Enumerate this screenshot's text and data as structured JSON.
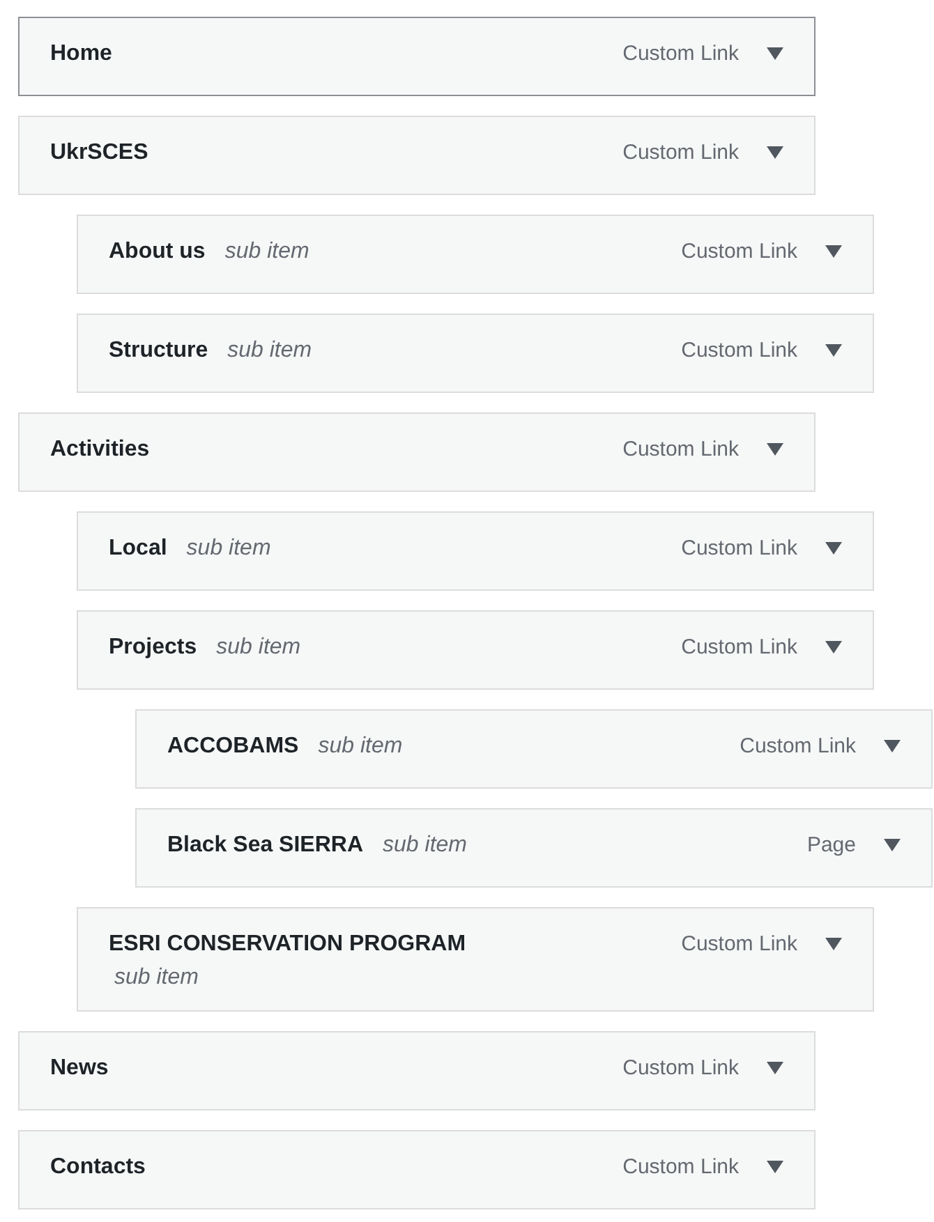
{
  "menu_items": [
    {
      "title": "Home",
      "type": "Custom Link",
      "selected": true
    },
    {
      "title": "UkrSCES",
      "type": "Custom Link",
      "selected": false,
      "children": [
        {
          "title": "About us",
          "sub_label": "sub item",
          "type": "Custom Link",
          "selected": false
        },
        {
          "title": "Structure",
          "sub_label": "sub item",
          "type": "Custom Link",
          "selected": false
        }
      ]
    },
    {
      "title": "Activities",
      "type": "Custom Link",
      "selected": false,
      "children": [
        {
          "title": "Local",
          "sub_label": "sub item",
          "type": "Custom Link",
          "selected": false
        },
        {
          "title": "Projects",
          "sub_label": "sub item",
          "type": "Custom Link",
          "selected": false,
          "children": [
            {
              "title": "ACCOBAMS",
              "sub_label": "sub item",
              "type": "Custom Link",
              "selected": false
            },
            {
              "title": "Black Sea SIERRA",
              "sub_label": "sub item",
              "type": "Page",
              "selected": false
            }
          ]
        },
        {
          "title": "ESRI CONSERVATION PROGRAM",
          "sub_label": "sub item",
          "type": "Custom Link",
          "selected": false
        }
      ]
    },
    {
      "title": "News",
      "type": "Custom Link",
      "selected": false
    },
    {
      "title": "Contacts",
      "type": "Custom Link",
      "selected": false
    }
  ]
}
